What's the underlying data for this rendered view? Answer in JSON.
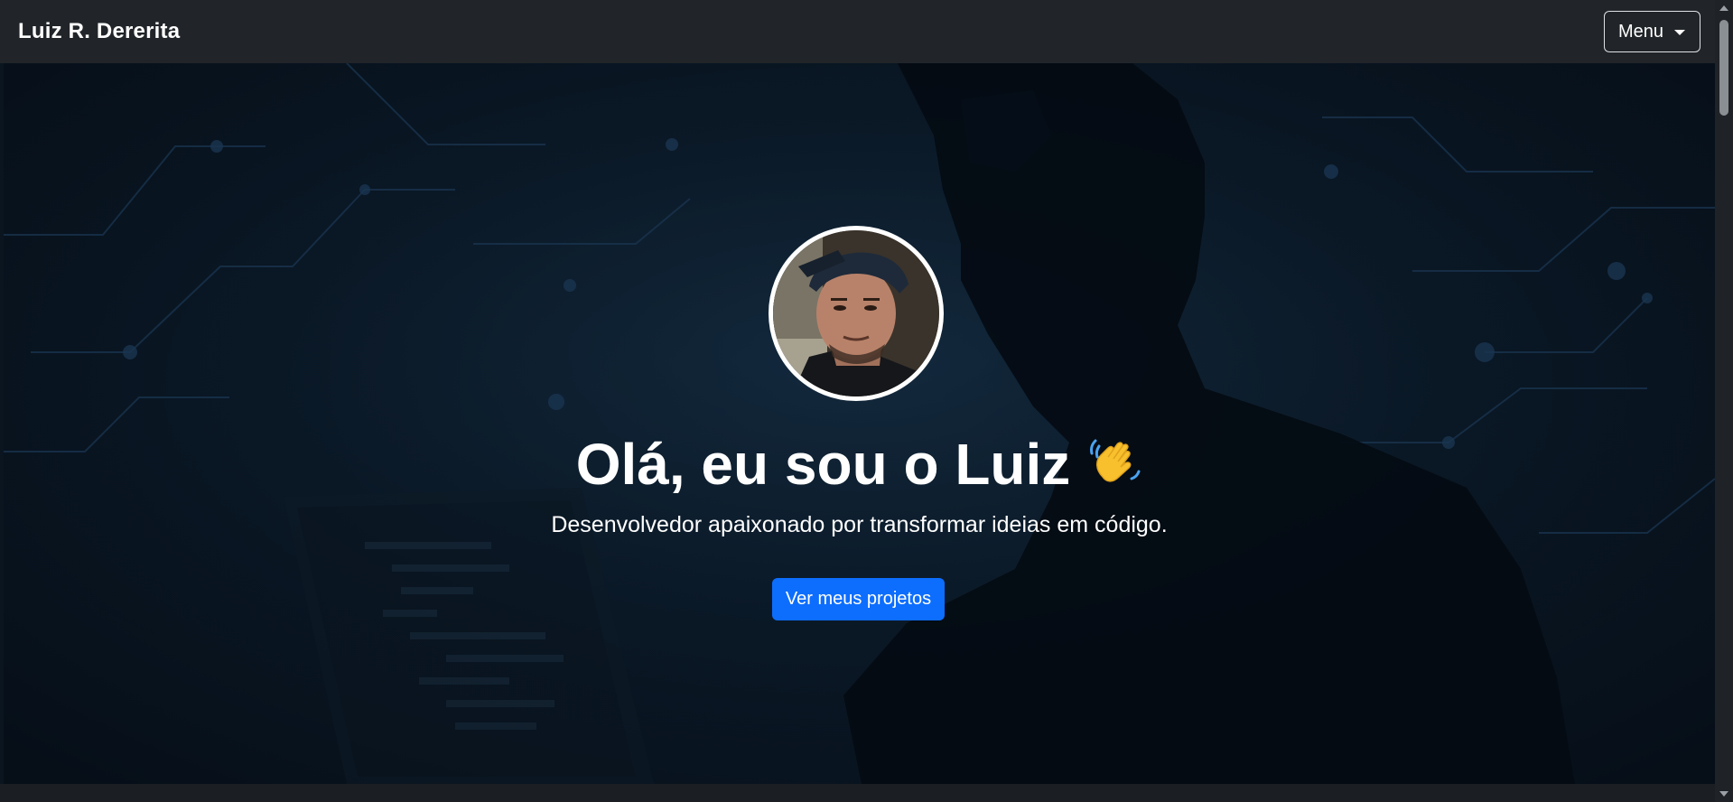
{
  "navbar": {
    "brand": "Luiz R. Dererita",
    "menu_label": "Menu",
    "menu_icon": "caret-down-icon"
  },
  "hero": {
    "title": "Olá, eu sou o Luiz",
    "emoji": "👋",
    "subtitle": "Desenvolvedor apaixonado por transformar ideias em código.",
    "cta_label": "Ver meus projetos"
  },
  "colors": {
    "navbar_bg": "#212529",
    "hero_bg": "#0a1826",
    "cta_bg": "#0d6efd",
    "text": "#ffffff"
  }
}
